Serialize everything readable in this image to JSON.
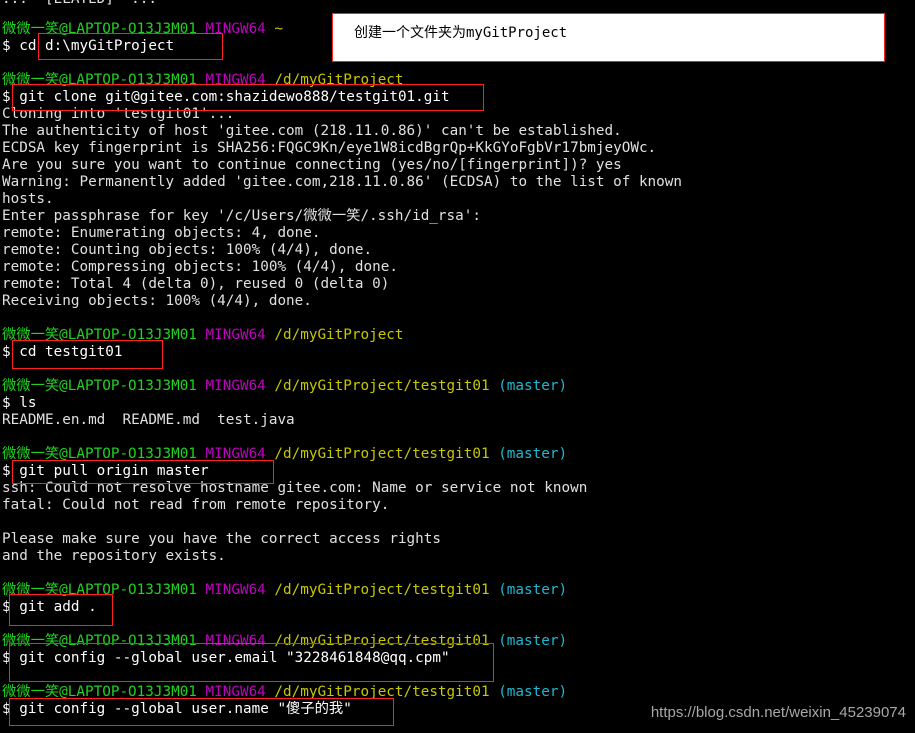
{
  "terminal": {
    "top_partial": "...  [ELATED]  ...",
    "blocks": [
      {
        "prompt": {
          "user": "微微一笑@LAPTOP-O13J3M01",
          "host": "MINGW64",
          "path": "~",
          "branch": ""
        },
        "command": "$ cd d:\\myGitProject",
        "output": []
      },
      {
        "prompt": {
          "user": "微微一笑@LAPTOP-O13J3M01",
          "host": "MINGW64",
          "path": "/d/myGitProject",
          "branch": ""
        },
        "command": "$ git clone git@gitee.com:shazidewo888/testgit01.git",
        "output": [
          "Cloning into 'testgit01'...",
          "The authenticity of host 'gitee.com (218.11.0.86)' can't be established.",
          "ECDSA key fingerprint is SHA256:FQGC9Kn/eye1W8icdBgrQp+KkGYoFgbVr17bmjeyOWc.",
          "Are you sure you want to continue connecting (yes/no/[fingerprint])? yes",
          "Warning: Permanently added 'gitee.com,218.11.0.86' (ECDSA) to the list of known",
          "hosts.",
          "Enter passphrase for key '/c/Users/微微一笑/.ssh/id_rsa':",
          "remote: Enumerating objects: 4, done.",
          "remote: Counting objects: 100% (4/4), done.",
          "remote: Compressing objects: 100% (4/4), done.",
          "remote: Total 4 (delta 0), reused 0 (delta 0)",
          "Receiving objects: 100% (4/4), done."
        ]
      },
      {
        "prompt": {
          "user": "微微一笑@LAPTOP-O13J3M01",
          "host": "MINGW64",
          "path": "/d/myGitProject",
          "branch": ""
        },
        "command": "$ cd testgit01",
        "output": []
      },
      {
        "prompt": {
          "user": "微微一笑@LAPTOP-O13J3M01",
          "host": "MINGW64",
          "path": "/d/myGitProject/testgit01",
          "branch": "(master)"
        },
        "command": "$ ls",
        "output": [
          "README.en.md  README.md  test.java"
        ]
      },
      {
        "prompt": {
          "user": "微微一笑@LAPTOP-O13J3M01",
          "host": "MINGW64",
          "path": "/d/myGitProject/testgit01",
          "branch": "(master)"
        },
        "command": "$ git pull origin master",
        "output": [
          "ssh: Could not resolve hostname gitee.com: Name or service not known",
          "fatal: Could not read from remote repository.",
          "",
          "Please make sure you have the correct access rights",
          "and the repository exists."
        ]
      },
      {
        "prompt": {
          "user": "微微一笑@LAPTOP-O13J3M01",
          "host": "MINGW64",
          "path": "/d/myGitProject/testgit01",
          "branch": "(master)"
        },
        "command": "$ git add .",
        "output": []
      },
      {
        "prompt": {
          "user": "微微一笑@LAPTOP-O13J3M01",
          "host": "MINGW64",
          "path": "/d/myGitProject/testgit01",
          "branch": "(master)"
        },
        "command": "$ git config --global user.email \"3228461848@qq.cpm\"",
        "output": []
      },
      {
        "prompt": {
          "user": "微微一笑@LAPTOP-O13J3M01",
          "host": "MINGW64",
          "path": "/d/myGitProject/testgit01",
          "branch": "(master)"
        },
        "command": "$ git config --global user.name \"傻子的我\"",
        "output": []
      }
    ]
  },
  "annotation": {
    "note": "创建一个文件夹为myGitProject"
  },
  "watermark": "https://blog.csdn.net/weixin_45239074",
  "colors": {
    "background": "#000000",
    "user": "#1fd31f",
    "host": "#c000c0",
    "path": "#c8c800",
    "branch": "#1fb8d0",
    "highlight_box": "#ff2020"
  }
}
